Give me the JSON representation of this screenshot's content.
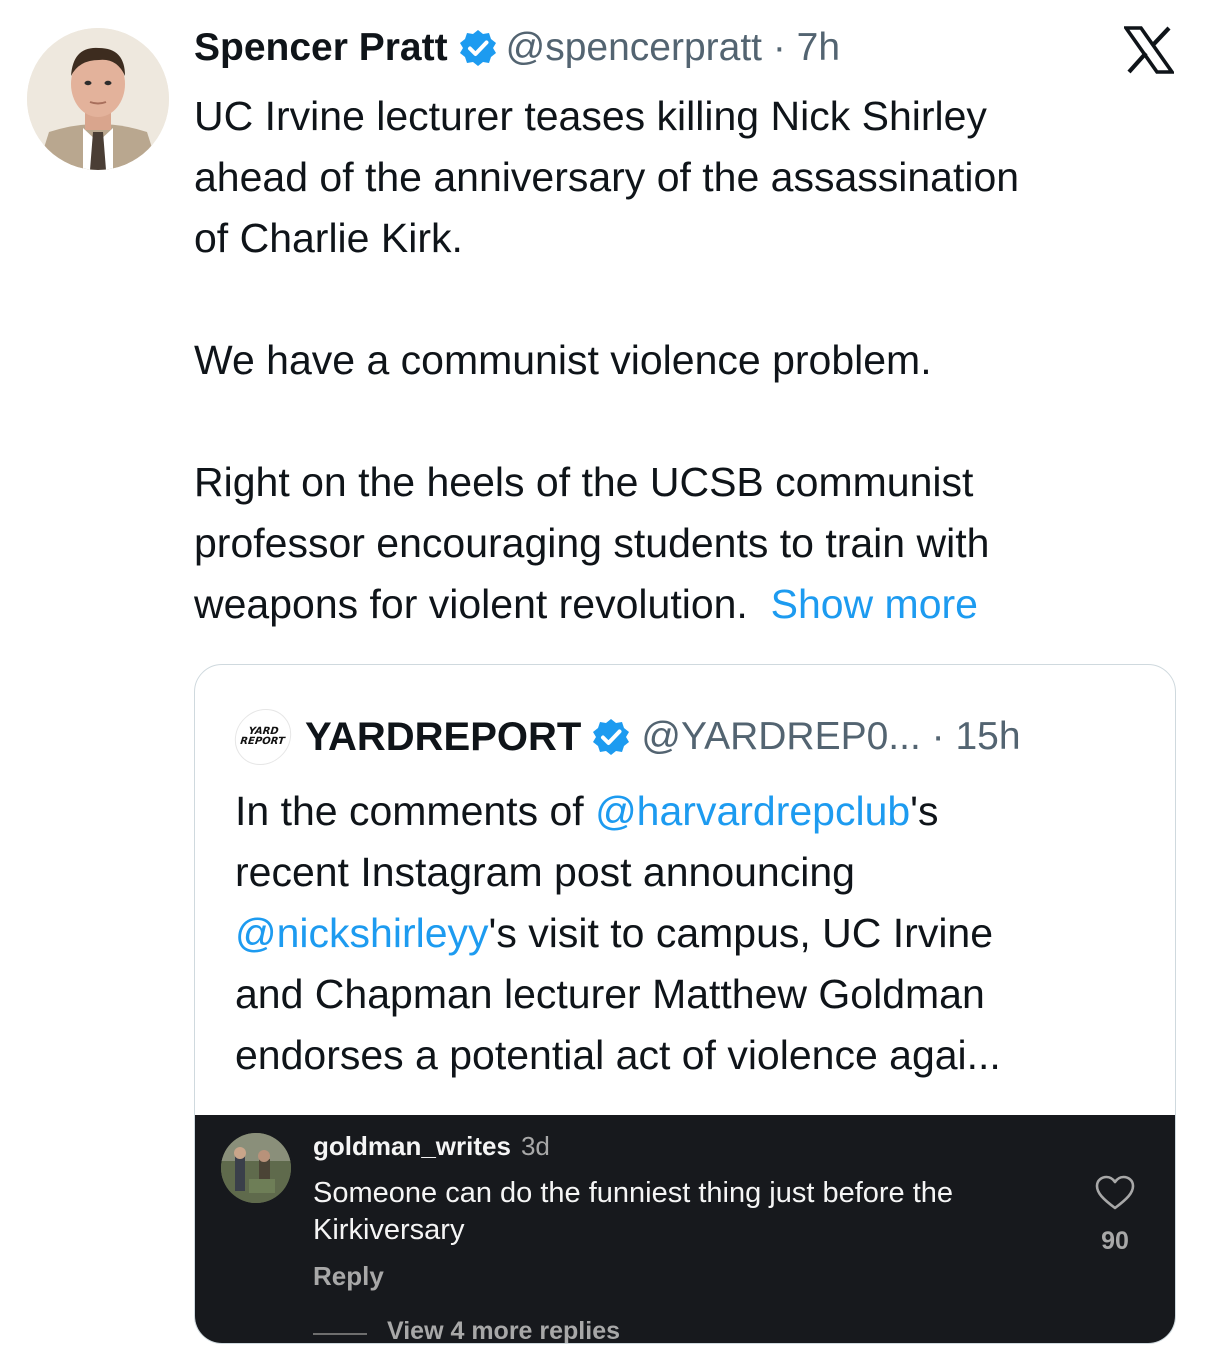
{
  "tweet": {
    "author_name": "Spencer Pratt",
    "handle_time": "@spencerpratt · 7h",
    "text_main": "UC Irvine lecturer teases killing Nick Shirley\nahead of the anniversary of the assassination\nof Charlie Kirk.\n\nWe have a communist violence problem.\n\nRight on the heels of the UCSB communist\nprofessor encouraging students to train with\nweapons for violent revolution.  ",
    "show_more": "Show more",
    "x_logo_icon": "x-logo-icon",
    "verified_icon": "verified-badge-icon"
  },
  "quote": {
    "logo_text_top": "YARD",
    "logo_text_bottom": "REPORT",
    "name": "YARDREPORT",
    "handle_time": "@YARDREP0... · 15h",
    "text_1": "In the comments of ",
    "mention_1": "@harvardrepclub",
    "text_2": "'s\nrecent Instagram post announcing\n",
    "mention_2": "@nickshirleyy",
    "text_3": "'s visit to campus, UC Irvine\nand Chapman lecturer Matthew Goldman\nendorses a potential act of violence agai...",
    "embedded_comment": {
      "username": "goldman_writes",
      "time": "3d",
      "comment": "Someone can do the funniest thing just before the Kirkiversary",
      "reply_label": "Reply",
      "likes": "90",
      "view_replies": "View 4 more replies"
    }
  },
  "colors": {
    "link": "#1d9bf0",
    "text": "#0f1419",
    "secondary": "#536471",
    "instagram_dark": "#17191d"
  }
}
